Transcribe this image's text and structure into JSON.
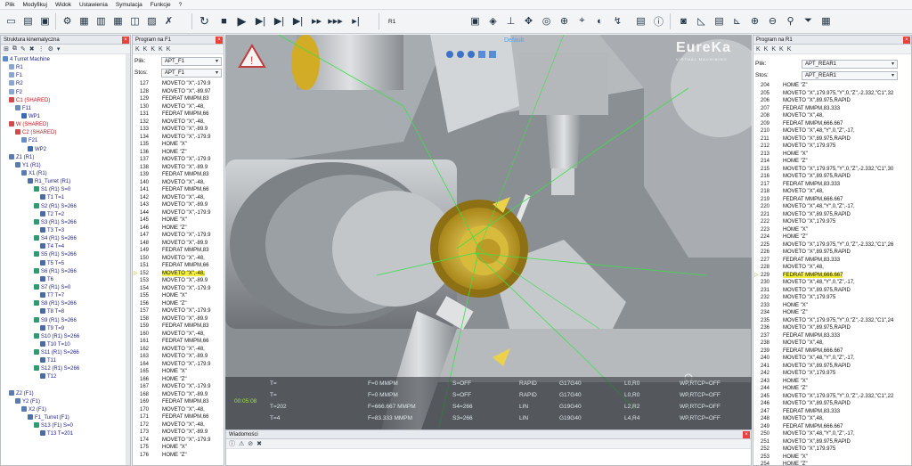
{
  "menu": [
    "Plik",
    "Modyfikuj",
    "Widok",
    "Ustawienia",
    "Symulacja",
    "Funkcje",
    "?"
  ],
  "toolbar": {
    "channel_label": "R1"
  },
  "kinematic": {
    "title": "Struktura kinematyczna",
    "rows": [
      {
        "d": 0,
        "t": "4 Turret Machine",
        "c": "blue",
        "i": "#5a8ad6"
      },
      {
        "d": 1,
        "t": "R1",
        "c": "blue",
        "i": "#8aa5d0"
      },
      {
        "d": 1,
        "t": "F1",
        "c": "blue",
        "i": "#8aa5d0"
      },
      {
        "d": 1,
        "t": "R2",
        "c": "blue",
        "i": "#8aa5d0"
      },
      {
        "d": 1,
        "t": "F2",
        "c": "blue",
        "i": "#8aa5d0"
      },
      {
        "d": 1,
        "t": "C1 (SHARED)",
        "c": "red",
        "i": "#d34a4a"
      },
      {
        "d": 2,
        "t": "F11",
        "c": "blue",
        "i": "#6a8cc0"
      },
      {
        "d": 3,
        "t": "WP1",
        "c": "blue",
        "i": "#3a6ab0"
      },
      {
        "d": 1,
        "t": "W (SHARED)",
        "c": "red",
        "i": "#d34a4a"
      },
      {
        "d": 2,
        "t": "C2 (SHARED)",
        "c": "red",
        "i": "#d34a4a"
      },
      {
        "d": 3,
        "t": "F21",
        "c": "blue",
        "i": "#6a8cc0"
      },
      {
        "d": 4,
        "t": "WP2",
        "c": "blue",
        "i": "#3a6ab0"
      },
      {
        "d": 1,
        "t": "Z1 (R1)",
        "c": "blue",
        "i": "#5a7bb0"
      },
      {
        "d": 2,
        "t": "Y1 (R1)",
        "c": "blue",
        "i": "#5a7bb0"
      },
      {
        "d": 3,
        "t": "X1 (R1)",
        "c": "blue",
        "i": "#5a7bb0"
      },
      {
        "d": 4,
        "t": "R1_Turret (R1)",
        "c": "blue",
        "i": "#4f6fa8"
      },
      {
        "d": 5,
        "t": "S1 (R1) S=0",
        "c": "blue",
        "i": "#2f9a70"
      },
      {
        "d": 6,
        "t": "T1 T=1",
        "c": "blue",
        "i": "#4a6aa8"
      },
      {
        "d": 5,
        "t": "S2 (R1) S=266",
        "c": "blue",
        "i": "#2f9a70"
      },
      {
        "d": 6,
        "t": "T2 T=2",
        "c": "blue",
        "i": "#4a6aa8"
      },
      {
        "d": 5,
        "t": "S3 (R1) S=266",
        "c": "blue",
        "i": "#2f9a70"
      },
      {
        "d": 6,
        "t": "T3 T=3",
        "c": "blue",
        "i": "#4a6aa8"
      },
      {
        "d": 5,
        "t": "S4 (R1) S=266",
        "c": "blue",
        "i": "#2f9a70"
      },
      {
        "d": 6,
        "t": "T4 T=4",
        "c": "blue",
        "i": "#4a6aa8"
      },
      {
        "d": 5,
        "t": "S5 (R1) S=266",
        "c": "blue",
        "i": "#2f9a70"
      },
      {
        "d": 6,
        "t": "T5 T=5",
        "c": "blue",
        "i": "#4a6aa8"
      },
      {
        "d": 5,
        "t": "S6 (R1) S=266",
        "c": "blue",
        "i": "#2f9a70"
      },
      {
        "d": 6,
        "t": "T6",
        "c": "blue",
        "i": "#4a6aa8"
      },
      {
        "d": 5,
        "t": "S7 (R1) S=0",
        "c": "blue",
        "i": "#2f9a70"
      },
      {
        "d": 6,
        "t": "T7 T=7",
        "c": "blue",
        "i": "#4a6aa8"
      },
      {
        "d": 5,
        "t": "S8 (R1) S=266",
        "c": "blue",
        "i": "#2f9a70"
      },
      {
        "d": 6,
        "t": "T8 T=8",
        "c": "blue",
        "i": "#4a6aa8"
      },
      {
        "d": 5,
        "t": "S9 (R1) S=266",
        "c": "blue",
        "i": "#2f9a70"
      },
      {
        "d": 6,
        "t": "T9 T=9",
        "c": "blue",
        "i": "#4a6aa8"
      },
      {
        "d": 5,
        "t": "S10 (R1) S=266",
        "c": "blue",
        "i": "#2f9a70"
      },
      {
        "d": 6,
        "t": "T10 T=10",
        "c": "blue",
        "i": "#4a6aa8"
      },
      {
        "d": 5,
        "t": "S11 (R1) S=266",
        "c": "blue",
        "i": "#2f9a70"
      },
      {
        "d": 6,
        "t": "T11",
        "c": "blue",
        "i": "#4a6aa8"
      },
      {
        "d": 5,
        "t": "S12 (R1) S=266",
        "c": "blue",
        "i": "#2f9a70"
      },
      {
        "d": 6,
        "t": "T12",
        "c": "blue",
        "i": "#4a6aa8"
      },
      {
        "d": 0,
        "t": "",
        "c": "blue",
        "i": ""
      },
      {
        "d": 1,
        "t": "Z2 (F1)",
        "c": "blue",
        "i": "#5a7bb0"
      },
      {
        "d": 2,
        "t": "Y2 (F1)",
        "c": "blue",
        "i": "#5a7bb0"
      },
      {
        "d": 3,
        "t": "X2 (F1)",
        "c": "blue",
        "i": "#5a7bb0"
      },
      {
        "d": 4,
        "t": "F1_Turret (F1)",
        "c": "blue",
        "i": "#4f6fa8"
      },
      {
        "d": 5,
        "t": "S13 (F1) S=0",
        "c": "blue",
        "i": "#2f9a70"
      },
      {
        "d": 6,
        "t": "T13 T=201",
        "c": "blue",
        "i": "#4a6aa8"
      }
    ]
  },
  "programF1": {
    "title": "Program na F1",
    "file_label": "Plik:",
    "file_value": "APT_F1",
    "stack_label": "Stos:",
    "stack_value": "APT_F1",
    "highlight_line": "152",
    "lines": [
      [
        "127",
        "MOVETO \"X\",-179.9"
      ],
      [
        "128",
        "MOVETO \"X\",-89.97"
      ],
      [
        "129",
        "FEDRAT MMPM,83"
      ],
      [
        "130",
        "MOVETO \"X\",-48,"
      ],
      [
        "131",
        "FEDRAT MMPM,66"
      ],
      [
        "132",
        "MOVETO \"X\",-48,"
      ],
      [
        "133",
        "MOVETO \"X\",-89.9"
      ],
      [
        "134",
        "MOVETO \"X\",-179.9"
      ],
      [
        "135",
        "HOME \"X\""
      ],
      [
        "136",
        "HOME \"Z\""
      ],
      [
        "137",
        "MOVETO \"X\",-179.9"
      ],
      [
        "138",
        "MOVETO \"X\",-89.9"
      ],
      [
        "139",
        "FEDRAT MMPM,83"
      ],
      [
        "140",
        "MOVETO \"X\",-48,"
      ],
      [
        "141",
        "FEDRAT MMPM,66"
      ],
      [
        "142",
        "MOVETO \"X\",-48,"
      ],
      [
        "143",
        "MOVETO \"X\",-89.9"
      ],
      [
        "144",
        "MOVETO \"X\",-179.9"
      ],
      [
        "145",
        "HOME \"X\""
      ],
      [
        "146",
        "HOME \"Z\""
      ],
      [
        "147",
        "MOVETO \"X\",-179.9"
      ],
      [
        "148",
        "MOVETO \"X\",-89.9"
      ],
      [
        "149",
        "FEDRAT MMPM,83"
      ],
      [
        "150",
        "MOVETO \"X\",-48,"
      ],
      [
        "151",
        "FEDRAT MMPM,66"
      ],
      [
        "152",
        "MOVETO \"X\",-48,"
      ],
      [
        "153",
        "MOVETO \"X\",-89.9"
      ],
      [
        "154",
        "MOVETO \"X\",-179.9"
      ],
      [
        "155",
        "HOME \"X\""
      ],
      [
        "156",
        "HOME \"Z\""
      ],
      [
        "157",
        "MOVETO \"X\",-179.9"
      ],
      [
        "158",
        "MOVETO \"X\",-89.9"
      ],
      [
        "159",
        "FEDRAT MMPM,83"
      ],
      [
        "160",
        "MOVETO \"X\",-48,"
      ],
      [
        "161",
        "FEDRAT MMPM,66"
      ],
      [
        "162",
        "MOVETO \"X\",-48,"
      ],
      [
        "163",
        "MOVETO \"X\",-89.9"
      ],
      [
        "164",
        "MOVETO \"X\",-179.9"
      ],
      [
        "165",
        "HOME \"X\""
      ],
      [
        "166",
        "HOME \"Z\""
      ],
      [
        "167",
        "MOVETO \"X\",-179.9"
      ],
      [
        "168",
        "MOVETO \"X\",-89.9"
      ],
      [
        "169",
        "FEDRAT MMPM,83"
      ],
      [
        "170",
        "MOVETO \"X\",-48,"
      ],
      [
        "171",
        "FEDRAT MMPM,66"
      ],
      [
        "172",
        "MOVETO \"X\",-48,"
      ],
      [
        "173",
        "MOVETO \"X\",-89.9"
      ],
      [
        "174",
        "MOVETO \"X\",-179.9"
      ],
      [
        "175",
        "HOME \"X\""
      ],
      [
        "176",
        "HOME \"Z\""
      ]
    ]
  },
  "programR1": {
    "title": "Program na R1",
    "file_label": "Plik:",
    "file_value": "APT_REAR1",
    "stack_label": "Stos:",
    "stack_value": "APT_REAR1",
    "highlight_line": "229",
    "lines": [
      [
        "204",
        "HOME \"Z\""
      ],
      [
        "205",
        "MOVETO \"X\",179.975,\"Y\",0,\"Z\",-2.332,\"C1\",32"
      ],
      [
        "206",
        "MOVETO \"X\",89.975,RAPID"
      ],
      [
        "207",
        "FEDRAT MMPM,83.333"
      ],
      [
        "208",
        "MOVETO \"X\",48,"
      ],
      [
        "209",
        "FEDRAT MMPM,666.667"
      ],
      [
        "210",
        "MOVETO \"X\",48,\"Y\",0,\"Z\",-17,"
      ],
      [
        "211",
        "MOVETO \"X\",89.975,RAPID"
      ],
      [
        "212",
        "MOVETO \"X\",179.975"
      ],
      [
        "213",
        "HOME \"X\""
      ],
      [
        "214",
        "HOME \"Z\""
      ],
      [
        "215",
        "MOVETO \"X\",179.975,\"Y\",0,\"Z\",-2.332,\"C1\",30"
      ],
      [
        "216",
        "MOVETO \"X\",89.975,RAPID"
      ],
      [
        "217",
        "FEDRAT MMPM,83.333"
      ],
      [
        "218",
        "MOVETO \"X\",48,"
      ],
      [
        "219",
        "FEDRAT MMPM,666.667"
      ],
      [
        "220",
        "MOVETO \"X\",48,\"Y\",0,\"Z\",-17,"
      ],
      [
        "221",
        "MOVETO \"X\",89.975,RAPID"
      ],
      [
        "222",
        "MOVETO \"X\",179.975"
      ],
      [
        "223",
        "HOME \"X\""
      ],
      [
        "224",
        "HOME \"Z\""
      ],
      [
        "225",
        "MOVETO \"X\",179.975,\"Y\",0,\"Z\",-2.332,\"C1\",26"
      ],
      [
        "226",
        "MOVETO \"X\",89.975,RAPID"
      ],
      [
        "227",
        "FEDRAT MMPM,83.333"
      ],
      [
        "228",
        "MOVETO \"X\",48,"
      ],
      [
        "229",
        "FEDRAT MMPM,666.667"
      ],
      [
        "230",
        "MOVETO \"X\",48,\"Y\",0,\"Z\",-17,"
      ],
      [
        "231",
        "MOVETO \"X\",89.975,RAPID"
      ],
      [
        "232",
        "MOVETO \"X\",179.975"
      ],
      [
        "233",
        "HOME \"X\""
      ],
      [
        "234",
        "HOME \"Z\""
      ],
      [
        "235",
        "MOVETO \"X\",179.975,\"Y\",0,\"Z\",-2.332,\"C1\",24"
      ],
      [
        "236",
        "MOVETO \"X\",89.975,RAPID"
      ],
      [
        "237",
        "FEDRAT MMPM,83.333"
      ],
      [
        "238",
        "MOVETO \"X\",48,"
      ],
      [
        "239",
        "FEDRAT MMPM,666.667"
      ],
      [
        "240",
        "MOVETO \"X\",48,\"Y\",0,\"Z\",-17,"
      ],
      [
        "241",
        "MOVETO \"X\",89.975,RAPID"
      ],
      [
        "242",
        "MOVETO \"X\",179.975"
      ],
      [
        "243",
        "HOME \"X\""
      ],
      [
        "244",
        "HOME \"Z\""
      ],
      [
        "245",
        "MOVETO \"X\",179.975,\"Y\",0,\"Z\",-2.332,\"C1\",22"
      ],
      [
        "246",
        "MOVETO \"X\",89.975,RAPID"
      ],
      [
        "247",
        "FEDRAT MMPM,83.333"
      ],
      [
        "248",
        "MOVETO \"X\",48,"
      ],
      [
        "249",
        "FEDRAT MMPM,666.667"
      ],
      [
        "250",
        "MOVETO \"X\",48,\"Y\",0,\"Z\",-17,"
      ],
      [
        "251",
        "MOVETO \"X\",89.975,RAPID"
      ],
      [
        "252",
        "MOVETO \"X\",179.975"
      ],
      [
        "253",
        "HOME \"X\""
      ],
      [
        "254",
        "HOME \"Z\""
      ]
    ]
  },
  "viewport": {
    "view_label": "Default",
    "logo": "EureKa",
    "logo_sub": "VIRTUAL MACHINING",
    "time": "00:05:08"
  },
  "status_rows": [
    [
      "T=",
      "F=0 MMPM",
      "S=OFF",
      "RAPID",
      "G17G40",
      "L0,R0",
      "WP,RTCP=OFF"
    ],
    [
      "T=",
      "F=0 MMPM",
      "S=OFF",
      "RAPID",
      "G17G40",
      "L0,R0",
      "WP,RTCP=OFF"
    ],
    [
      "T=202",
      "F=666.667 MMPM",
      "S4=266",
      "LIN",
      "G19G40",
      "L2,R2",
      "WP,RTCP=OFF"
    ],
    [
      "T=4",
      "F=83.333 MMPM",
      "S3=266",
      "LIN",
      "G19G40",
      "L4,R4",
      "WP,RTCP=OFF"
    ]
  ],
  "messages": {
    "title": "Wiadomości"
  },
  "colors": {
    "highlight": "#f2ee3c",
    "accent_gold": "#d8b93a",
    "toolpath": "#39e04a"
  }
}
